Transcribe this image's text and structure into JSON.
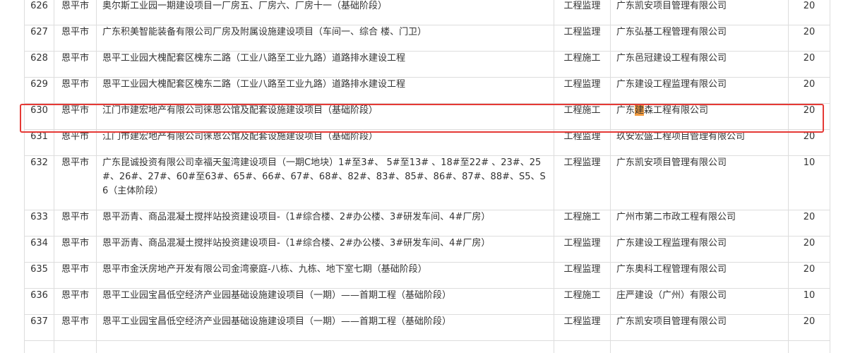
{
  "rows": [
    {
      "no": "626",
      "city": "恩平市",
      "project": "奥尔斯工业园一期建设项目一厂房五、厂房六、厂房十一（基础阶段）",
      "type": "工程监理",
      "company": "广东凯安项目管理有限公司",
      "score": "20"
    },
    {
      "no": "627",
      "city": "恩平市",
      "project": "广东积美智能装备有限公司厂房及附属设施建设项目（车间一、综合 楼、门卫）",
      "type": "工程监理",
      "company": "广东弘基工程管理有限公司",
      "score": "20"
    },
    {
      "no": "628",
      "city": "恩平市",
      "project": "恩平工业园大槐配套区槐东二路（工业八路至工业九路）道路排水建设工程",
      "type": "工程施工",
      "company": "广东邑冠建设工程有限公司",
      "score": "20"
    },
    {
      "no": "629",
      "city": "恩平市",
      "project": "恩平工业园大槐配套区槐东二路（工业八路至工业九路）道路排水建设工程",
      "type": "工程监理",
      "company": "广东建设工程监理有限公司",
      "score": "20"
    },
    {
      "no": "630",
      "city": "恩平市",
      "project": "江门市建宏地产有限公司徕恩公馆及配套设施建设项目（基础阶段）",
      "type": "工程施工",
      "company_pre": "广东",
      "company_hl": "建",
      "company_post": "森工程有限公司",
      "score": "20"
    },
    {
      "no": "631",
      "city": "恩平市",
      "project": "江门市建宏地产有限公司徕恩公馆及配套设施建设项目（基础阶段）",
      "type": "工程监理",
      "company": "玖安宏盛工程项目管理有限公司",
      "score": "20"
    },
    {
      "no": "632",
      "city": "恩平市",
      "project": "广东昆诚投资有限公司幸福天玺湾建设项目（一期C地块）1#至3#、 5#至13# 、18#至22# 、23#、25#、26#、27#、60#至63#、65#、66#、67#、68#、82#、83#、85#、86#、87#、88#、S5、S6（主体阶段）",
      "type": "工程监理",
      "company": "广东凯安项目管理有限公司",
      "score": "10"
    },
    {
      "no": "633",
      "city": "恩平市",
      "project": "恩平沥青、商品混凝土搅拌站投资建设项目-（1#综合楼、2#办公楼、3#研发车间、4#厂房）",
      "type": "工程施工",
      "company": "广州市第二市政工程有限公司",
      "score": "20"
    },
    {
      "no": "634",
      "city": "恩平市",
      "project": "恩平沥青、商品混凝土搅拌站投资建设项目-（1#综合楼、2#办公楼、3#研发车间、4#厂房）",
      "type": "工程监理",
      "company": "广东建设工程监理有限公司",
      "score": "20"
    },
    {
      "no": "635",
      "city": "恩平市",
      "project": "恩平市金沃房地产开发有限公司金湾豪庭-八栋、九栋、地下室七期（基础阶段）",
      "type": "工程监理",
      "company": "广东奥科工程管理有限公司",
      "score": "20"
    },
    {
      "no": "636",
      "city": "恩平市",
      "project": "恩平工业园宝昌低空经济产业园基础设施建设项目（一期）——首期工程（基础阶段）",
      "type": "工程施工",
      "company": "庄严建设（广州）有限公司",
      "score": "10"
    },
    {
      "no": "637",
      "city": "恩平市",
      "project": "恩平工业园宝昌低空经济产业园基础设施建设项目（一期）——首期工程（基础阶段）",
      "type": "工程监理",
      "company": "广东凯安项目管理有限公司",
      "score": "20"
    }
  ],
  "colors": {
    "border": "#dddddd",
    "text": "#333333",
    "highlight_frame": "#e53935",
    "search_hit": "#f29b3f"
  }
}
